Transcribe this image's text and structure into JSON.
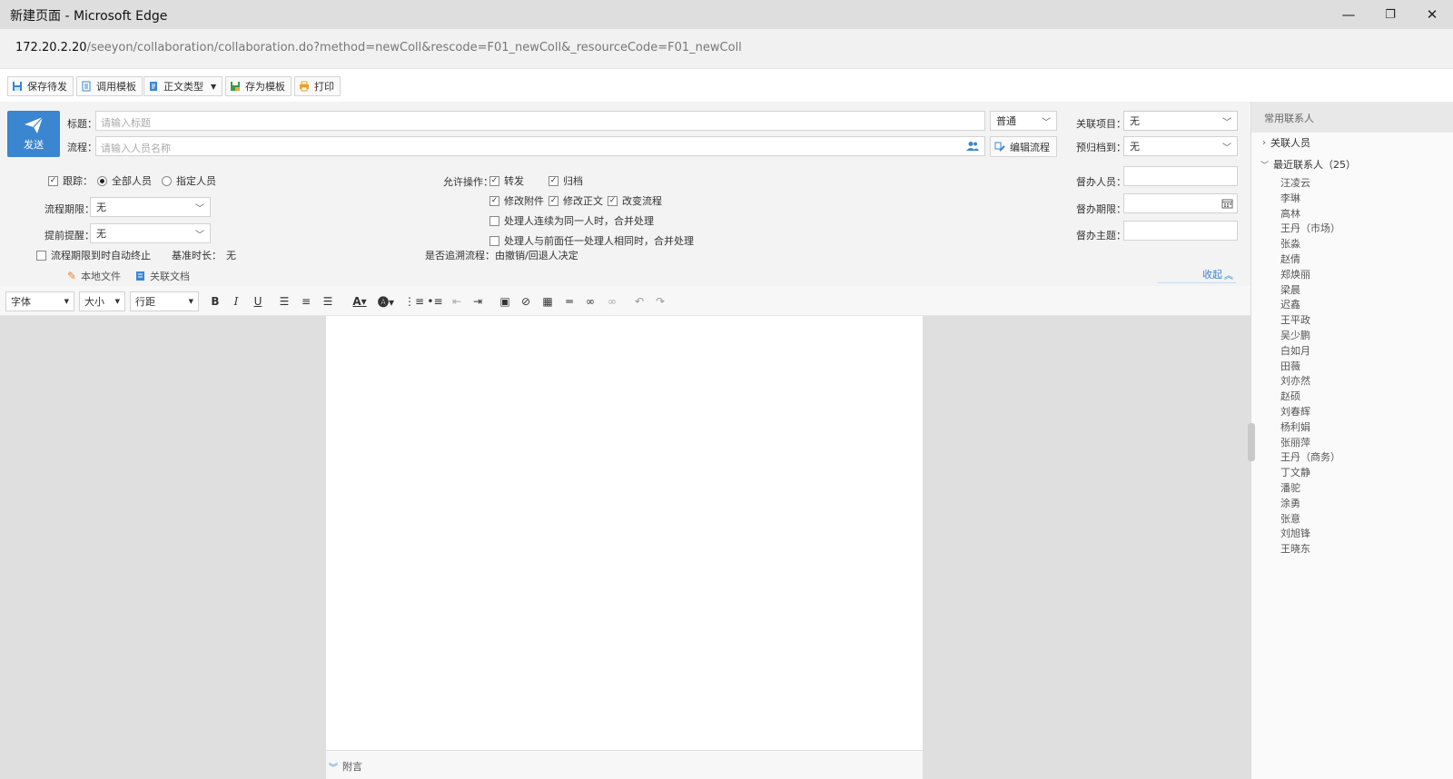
{
  "window": {
    "title": "新建页面 - Microsoft Edge",
    "minimize": "—",
    "restore": "❐",
    "close": "✕"
  },
  "address": {
    "host": "172.20.2.20",
    "path": "/seeyon/collaboration/collaboration.do?method=newColl&rescode=F01_newColl&_resourceCode=F01_newColl"
  },
  "toolbar": {
    "save_draft": "保存待发",
    "use_template": "调用模板",
    "body_type": "正文类型",
    "save_template": "存为模板",
    "print": "打印"
  },
  "form": {
    "send_label": "发送",
    "title_label": "标题：",
    "title_placeholder": "请输入标题",
    "priority": "普通",
    "flow_label": "流程：",
    "flow_placeholder": "请输入人员名称",
    "edit_flow": "编辑流程",
    "related_project_label": "关联项目：",
    "related_project_value": "无",
    "archive_label": "预归档到：",
    "archive_value": "无",
    "track_label": "跟踪：",
    "track_all": "全部人员",
    "track_specified": "指定人员",
    "deadline_label": "流程期限：",
    "deadline_value": "无",
    "remind_label": "提前提醒：",
    "remind_value": "无",
    "auto_end": "流程期限到时自动终止",
    "base_time_label": "基准时长：",
    "base_time_value": "无",
    "local_file": "本地文件",
    "related_doc": "关联文档",
    "allow_ops_label": "允许操作：",
    "op_forward": "转发",
    "op_archive": "归档",
    "op_modify_attach": "修改附件",
    "op_modify_body": "修改正文",
    "op_change_flow": "改变流程",
    "op_merge_same": "处理人连续为同一人时，合并处理",
    "op_merge_prev": "处理人与前面任一处理人相同时，合并处理",
    "retrace_label": "是否追溯流程：",
    "retrace_value": "由撤销/回退人决定",
    "supervisor_label": "督办人员：",
    "supervise_deadline_label": "督办期限：",
    "supervise_topic_label": "督办主题：",
    "collapse": "收起"
  },
  "editor": {
    "font": "字体",
    "size": "大小",
    "line_height": "行距",
    "attachment_bar": "附言"
  },
  "sidebar": {
    "header": "常用联系人",
    "related_people": "关联人员",
    "recent_label": "最近联系人（25）",
    "contacts": [
      "汪凌云",
      "李琳",
      "高林",
      "王丹（市场）",
      "张淼",
      "赵倩",
      "郑焕丽",
      "梁晨",
      "迟鑫",
      "王平政",
      "吴少鹏",
      "白如月",
      "田薇",
      "刘亦然",
      "赵硕",
      "刘春辉",
      "杨利娟",
      "张丽萍",
      "王丹（商务）",
      "丁文静",
      "潘驼",
      "涂勇",
      "张意",
      "刘旭锋",
      "王晓东"
    ]
  },
  "colors": {
    "accent": "#3b86d1",
    "titlebar": "#dedede",
    "form_bg": "#f3f3f3",
    "canvas": "#dfdfdf"
  }
}
